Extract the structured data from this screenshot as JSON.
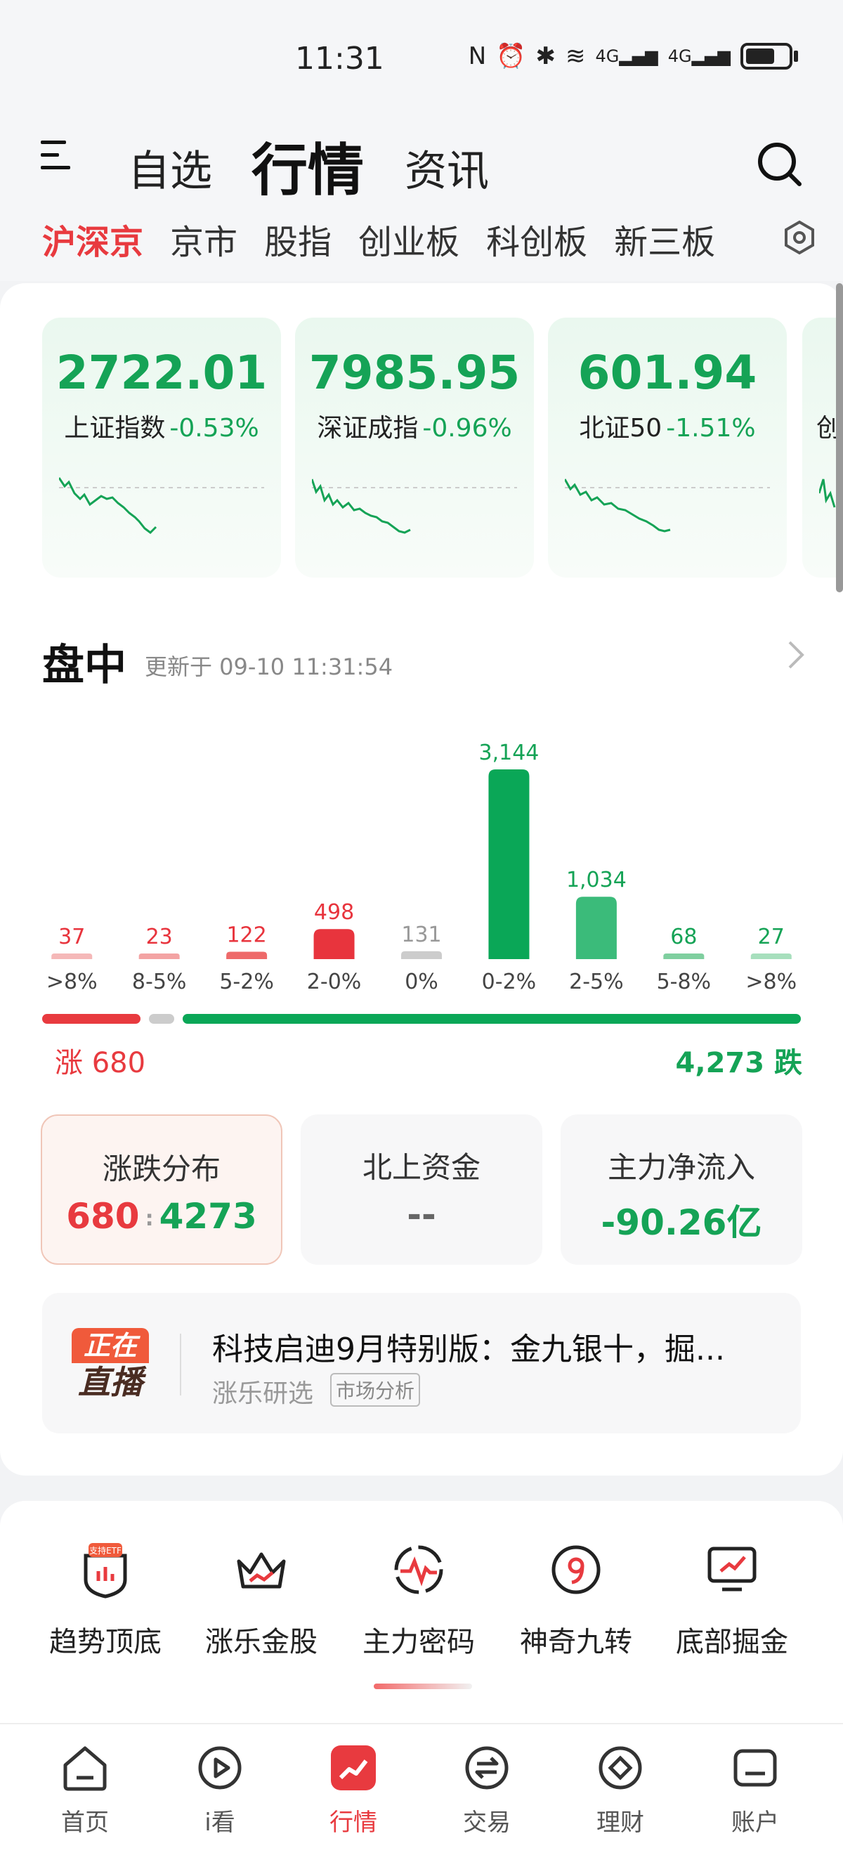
{
  "status_bar": {
    "time": "11:31",
    "network_1": "4G",
    "network_2": "4G"
  },
  "header": {
    "tabs": [
      {
        "label": "自选",
        "active": false
      },
      {
        "label": "行情",
        "active": true
      },
      {
        "label": "资讯",
        "active": false
      }
    ],
    "menu_icon": "menu-icon",
    "search_icon": "search-icon"
  },
  "market_tabs": [
    {
      "label": "沪深京",
      "active": true
    },
    {
      "label": "京市",
      "active": false
    },
    {
      "label": "股指",
      "active": false
    },
    {
      "label": "创业板",
      "active": false
    },
    {
      "label": "科创板",
      "active": false
    },
    {
      "label": "新三板",
      "active": false
    }
  ],
  "indices": [
    {
      "name": "上证指数",
      "value": "2722.01",
      "change": "-0.53%"
    },
    {
      "name": "深证成指",
      "value": "7985.95",
      "change": "-0.96%"
    },
    {
      "name": "北证50",
      "value": "601.94",
      "change": "-1.51%"
    }
  ],
  "partial_index_text": "创",
  "intraday": {
    "title": "盘中",
    "updated": "更新于 09-10 11:31:54"
  },
  "chart_data": {
    "type": "bar",
    "categories": [
      ">8%",
      "8-5%",
      "5-2%",
      "2-0%",
      "0%",
      "0-2%",
      "2-5%",
      "5-8%",
      ">8%"
    ],
    "values": [
      37,
      23,
      122,
      498,
      131,
      3144,
      1034,
      68,
      27
    ],
    "labels": [
      "37",
      "23",
      "122",
      "498",
      "131",
      "3,144",
      "1,034",
      "68",
      "27"
    ],
    "colors": [
      "#f5b8b8",
      "#f3a3a3",
      "#ee6a6a",
      "#e8343d",
      "#cccccc",
      "#0aa757",
      "#3bbb7a",
      "#7fcf9f",
      "#a7dfbd"
    ],
    "label_colors": [
      "#e8343d",
      "#e8343d",
      "#e8343d",
      "#e8343d",
      "#999999",
      "#15a356",
      "#15a356",
      "#15a356",
      "#15a356"
    ]
  },
  "breadth": {
    "rise_label": "涨 680",
    "fall_label": "4,273 跌",
    "rise": 680,
    "flat": 131,
    "fall": 4273
  },
  "stats": [
    {
      "title": "涨跌分布",
      "up": "680",
      "down": "4273"
    },
    {
      "title": "北上资金",
      "value": "--"
    },
    {
      "title": "主力净流入",
      "value": "-90.26亿"
    }
  ],
  "live": {
    "badge_top": "正在",
    "badge_bottom": "直播",
    "title": "科技启迪9月特别版：金九银十，掘...",
    "source": "涨乐研选",
    "tag": "市场分析"
  },
  "tools": [
    {
      "label": "趋势顶底",
      "icon": "shield-etf-icon",
      "badge": "支持ETF"
    },
    {
      "label": "涨乐金股",
      "icon": "crown-icon"
    },
    {
      "label": "主力密码",
      "icon": "pulse-icon"
    },
    {
      "label": "神奇九转",
      "icon": "nine-icon"
    },
    {
      "label": "底部掘金",
      "icon": "monitor-icon"
    }
  ],
  "bottom_nav": [
    {
      "label": "首页",
      "icon": "home-icon",
      "active": false
    },
    {
      "label": "i看",
      "icon": "play-icon",
      "active": false
    },
    {
      "label": "行情",
      "icon": "chart-icon",
      "active": true
    },
    {
      "label": "交易",
      "icon": "exchange-icon",
      "active": false
    },
    {
      "label": "理财",
      "icon": "diamond-icon",
      "active": false
    },
    {
      "label": "账户",
      "icon": "account-icon",
      "active": false
    }
  ],
  "colors": {
    "red": "#e83a3f",
    "green": "#15a356",
    "gray": "#cccccc"
  }
}
